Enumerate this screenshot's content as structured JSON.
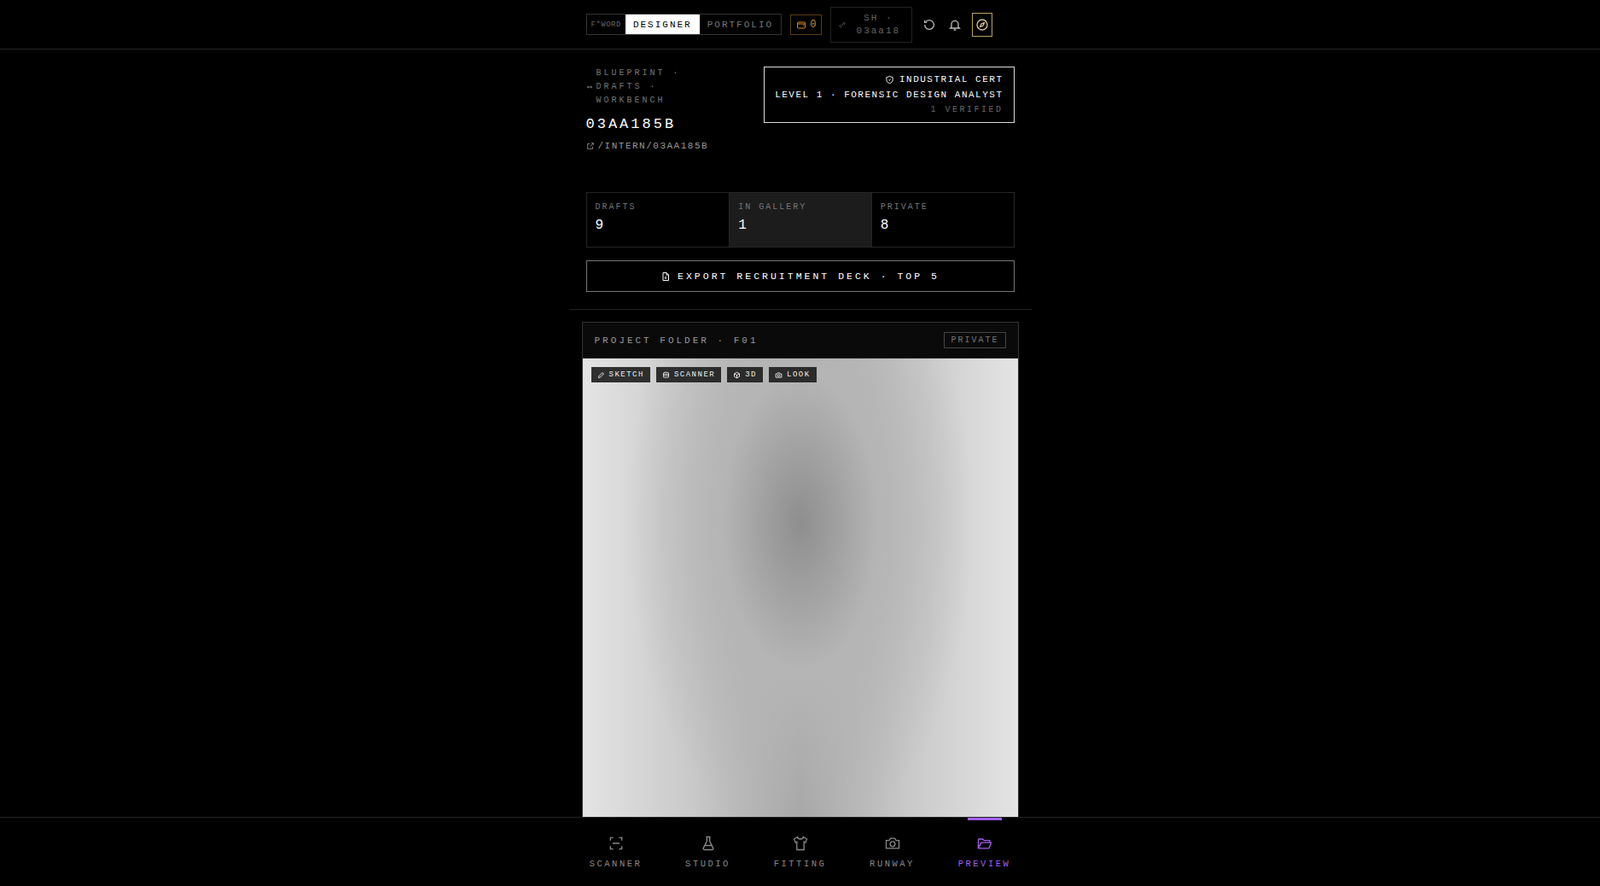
{
  "topbar": {
    "modes": [
      {
        "label": "F*WORD",
        "selected": false
      },
      {
        "label": "DESIGNER",
        "selected": true
      },
      {
        "label": "PORTFOLIO",
        "selected": false
      }
    ],
    "credits": "0",
    "session": "SH · 03aa18"
  },
  "header": {
    "breadcrumb": "BLUEPRINT · DRAFTS · WORKBENCH",
    "title": "03AA185B",
    "link": "/INTERN/03AA185B"
  },
  "cert": {
    "label": "INDUSTRIAL CERT",
    "level": "LEVEL 1 · FORENSIC DESIGN ANALYST",
    "verified": "1 VERIFIED"
  },
  "stats": [
    {
      "label": "DRAFTS",
      "value": "9",
      "selected": false
    },
    {
      "label": "IN GALLERY",
      "value": "1",
      "selected": true
    },
    {
      "label": "PRIVATE",
      "value": "8",
      "selected": false
    }
  ],
  "export_button": "EXPORT RECRUITMENT DECK · TOP 5",
  "folder": {
    "title": "PROJECT FOLDER · F01",
    "badge": "PRIVATE",
    "tags": [
      "SKETCH",
      "SCANNER",
      "3D",
      "LOOK"
    ]
  },
  "nav": [
    {
      "label": "SCANNER",
      "selected": false
    },
    {
      "label": "STUDIO",
      "selected": false
    },
    {
      "label": "FITTING",
      "selected": false
    },
    {
      "label": "RUNWAY",
      "selected": false
    },
    {
      "label": "PREVIEW",
      "selected": true
    }
  ]
}
